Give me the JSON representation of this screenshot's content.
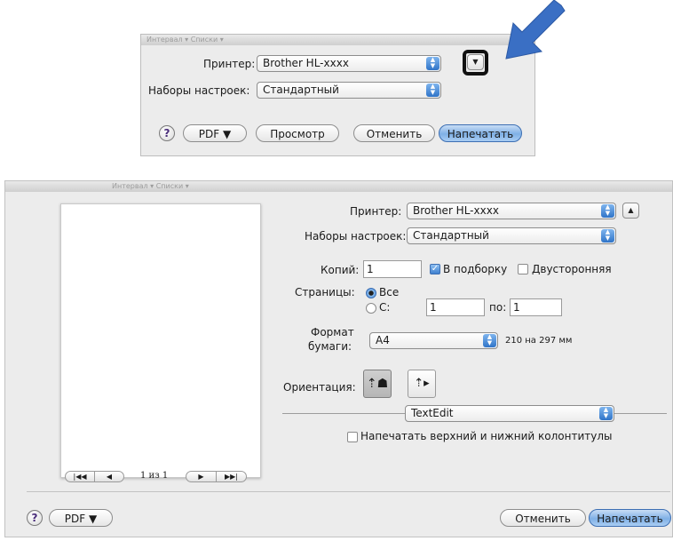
{
  "top_dialog": {
    "printer_label": "Принтер:",
    "printer_value": "Brother HL-xxxx",
    "presets_label": "Наборы настроек:",
    "presets_value": "Стандартный",
    "expand_icon": "triangle-down-icon",
    "help_label": "?",
    "pdf_label": "PDF ▼",
    "preview_label": "Просмотр",
    "cancel_label": "Отменить",
    "print_label": "Напечатать",
    "ghost_toolbar_text": "Интервал     ▾     Списки     ▾"
  },
  "annotation": {
    "arrow_icon": "blue-arrow-icon",
    "arrow_color": "#3a6fc4",
    "highlight_color": "#111111"
  },
  "bottom_dialog": {
    "ghost_toolbar_text": "Интервал     ▾     Списки     ▾",
    "printer_label": "Принтер:",
    "printer_value": "Brother HL-xxxx",
    "collapse_icon": "triangle-up-icon",
    "presets_label": "Наборы настроек:",
    "presets_value": "Стандартный",
    "copies_label": "Копий:",
    "copies_value": "1",
    "collate_label": "В подборку",
    "collate_checked": true,
    "duplex_label": "Двусторонняя",
    "duplex_checked": false,
    "pages_label": "Страницы:",
    "pages_all_label": "Все",
    "pages_from_label": "С:",
    "pages_from_value": "1",
    "pages_to_label": "по:",
    "pages_to_value": "1",
    "paper_size_label_line1": "Формат",
    "paper_size_label_line2": "бумаги:",
    "paper_size_value": "A4",
    "paper_size_dims": "210 на 297 мм",
    "orientation_label": "Ориентация:",
    "section_value": "TextEdit",
    "header_footer_label": "Напечатать верхний и нижний колонтитулы",
    "header_footer_checked": false,
    "page_counter": "1 из 1",
    "help_label": "?",
    "pdf_label": "PDF ▼",
    "cancel_label": "Отменить",
    "print_label": "Напечатать"
  }
}
